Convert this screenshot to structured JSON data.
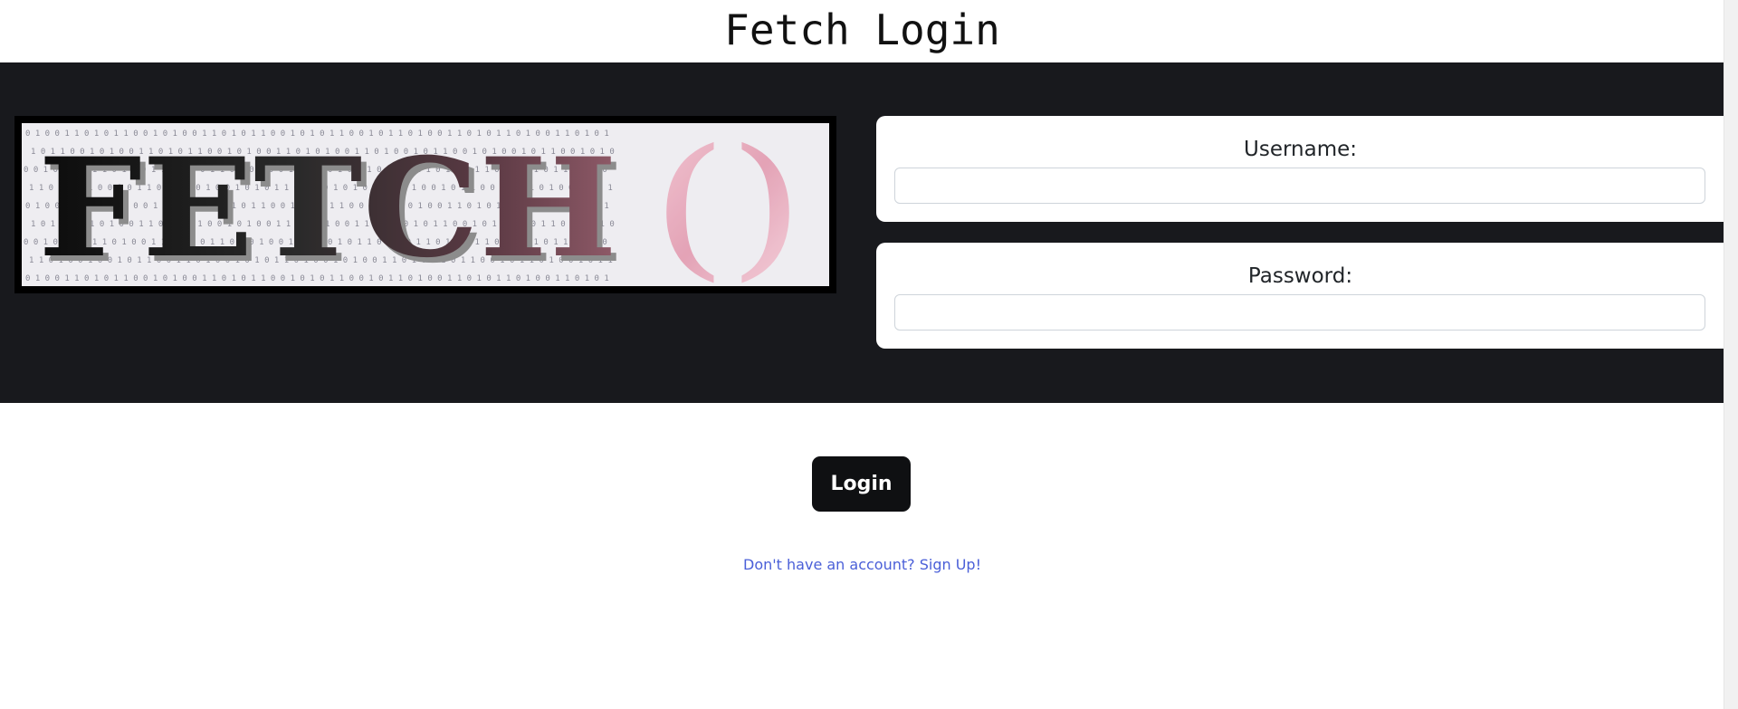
{
  "page": {
    "title": "Fetch Login"
  },
  "logo": {
    "text": "FETCH()",
    "letters_main": "FETCH",
    "letters_parens": "()",
    "binary_rows": [
      "0 1 0 0 1 1 0 1 0 1 1 0 0 1 0 1 0 0 1 1 0 1 0 1 1 0 0 1 0 1 0 1 1 0 0 1 0 1 1 0 1 0 0 1 1 0 1 0 1 1 0 1 0 0 1 1 0 1 0 1",
      "1 0 1 1 0 0 1 0 1 0 0 1 1 0 1 0 1 1 0 0 1 0 1 0 0 1 1 0 1 0 1 0 0 1 1 0 1 0 0 1 0 1 1 0 0 1 0 1 0 0 1 0 1 1 0 0 1 0 1 0",
      "0 0 1 0 1 1 0 1 1 0 1 0 0 1 1 0 0 1 0 1 1 0 1 0 1 0 0 1 0 1 1 0 1 0 1 1 0 0 1 0 1 1 0 1 0 0 1 1 0 1 0 0 1 0 1 1 0 1 0 0",
      "1 1 0 1 0 0 1 0 0 1 0 1 1 0 0 1 1 0 1 0 0 1 0 1 0 1 1 0 1 0 0 1 0 1 0 0 1 1 0 1 0 0 1 0 1 1 0 0 1 0 1 1 0 1 0 0 1 0 1 1"
    ]
  },
  "form": {
    "username_label": "Username:",
    "username_value": "",
    "password_label": "Password:",
    "password_value": "",
    "login_label": "Login",
    "signup_text": "Don't have an account? Sign Up!"
  },
  "colors": {
    "band": "#18191d",
    "button": "#0f1012",
    "link": "#4a5fd8",
    "parens": "#e8a6b8"
  }
}
